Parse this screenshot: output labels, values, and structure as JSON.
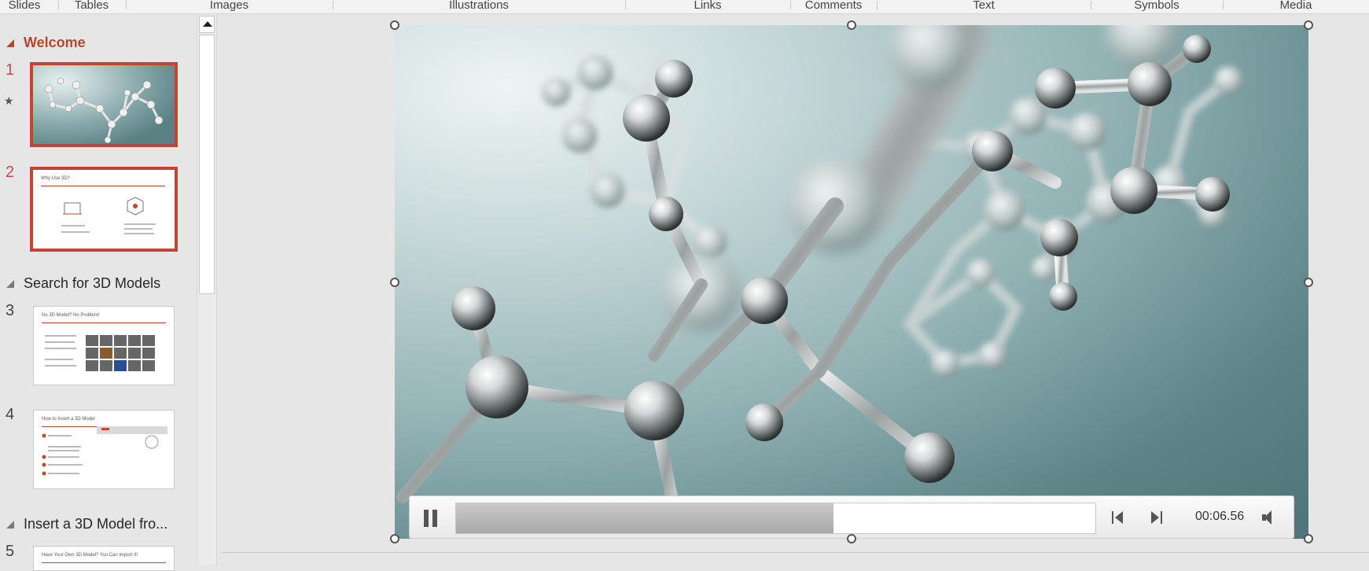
{
  "ribbon": {
    "groups": [
      "Slides",
      "Tables",
      "Images",
      "Illustrations",
      "Links",
      "Comments",
      "Text",
      "Symbols",
      "Media"
    ]
  },
  "thumbnails": {
    "sections": [
      {
        "label": "Welcome",
        "active": true
      },
      {
        "label": "Search for 3D Models",
        "active": false
      },
      {
        "label": "Insert a 3D Model fro...",
        "active": false
      }
    ],
    "slides": [
      {
        "number": "1",
        "title": "",
        "selected": true
      },
      {
        "number": "2",
        "title": "Why Use 3D?",
        "selected": true
      },
      {
        "number": "3",
        "title": "No 3D Model? No Problem!",
        "selected": false
      },
      {
        "number": "4",
        "title": "How to Insert a 3D Model",
        "selected": false
      },
      {
        "number": "5",
        "title": "Have Your Own 3D Model? You Can Import It!",
        "selected": false
      }
    ],
    "slide1_icon": "animation-star-icon"
  },
  "media": {
    "time": "00:06.56",
    "progress": 0.59,
    "icons": {
      "pause": "pause-icon",
      "back": "step-back-icon",
      "forward": "step-forward-icon",
      "volume": "volume-icon"
    }
  },
  "colors": {
    "accent": "#c0462d",
    "section_active": "#b7472a",
    "background": "#e6e6e6"
  }
}
